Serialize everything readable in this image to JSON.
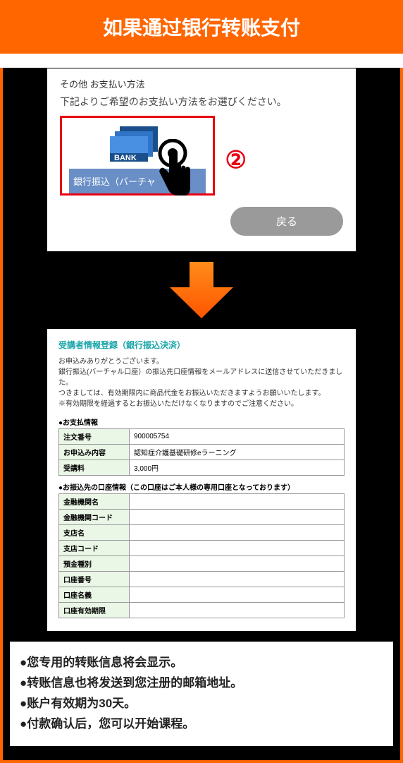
{
  "header": "如果通过银行转账支付",
  "panel1": {
    "title": "その他 お支払い方法",
    "desc": "下記よりご希望のお支払い方法をお選びください。",
    "bank_label": "BANK",
    "option_label": "銀行振込（バーチャ",
    "step_marker": "②",
    "back_label": "戻る"
  },
  "panel2": {
    "title": "受講者情報登録（銀行振込決済）",
    "msg1": "お申込みありがとうございます。",
    "msg2": "銀行振込(バーチャル口座）の振込先口座情報をメールアドレスに送信させていただきました。",
    "msg3": "つきましては、有効期限内に商品代金をお振込いただきますようお願いいたします。",
    "msg4": "※有効期限を経過するとお振込いただけなくなりますのでご注意ください。",
    "sect1_head": "●お支払情報",
    "rows1": [
      {
        "label": "注文番号",
        "value": "900005754"
      },
      {
        "label": "お申込み内容",
        "value": "認知症介護基礎研修eラーニング"
      },
      {
        "label": "受講料",
        "value": "3,000円"
      }
    ],
    "sect2_head": "●お振込先の口座情報（この口座はご本人様の専用口座となっております）",
    "rows2": [
      {
        "label": "金融機関名",
        "value": ""
      },
      {
        "label": "金融機関コード",
        "value": ""
      },
      {
        "label": "支店名",
        "value": ""
      },
      {
        "label": "支店コード",
        "value": ""
      },
      {
        "label": "預金種別",
        "value": ""
      },
      {
        "label": "口座番号",
        "value": ""
      },
      {
        "label": "口座名義",
        "value": ""
      },
      {
        "label": "口座有効期限",
        "value": ""
      }
    ]
  },
  "bullets": [
    "●您专用的转账信息将会显示。",
    "●转账信息也将发送到您注册的邮箱地址。",
    "●账户有效期为30天。",
    "●付款确认后，您可以开始课程。"
  ]
}
